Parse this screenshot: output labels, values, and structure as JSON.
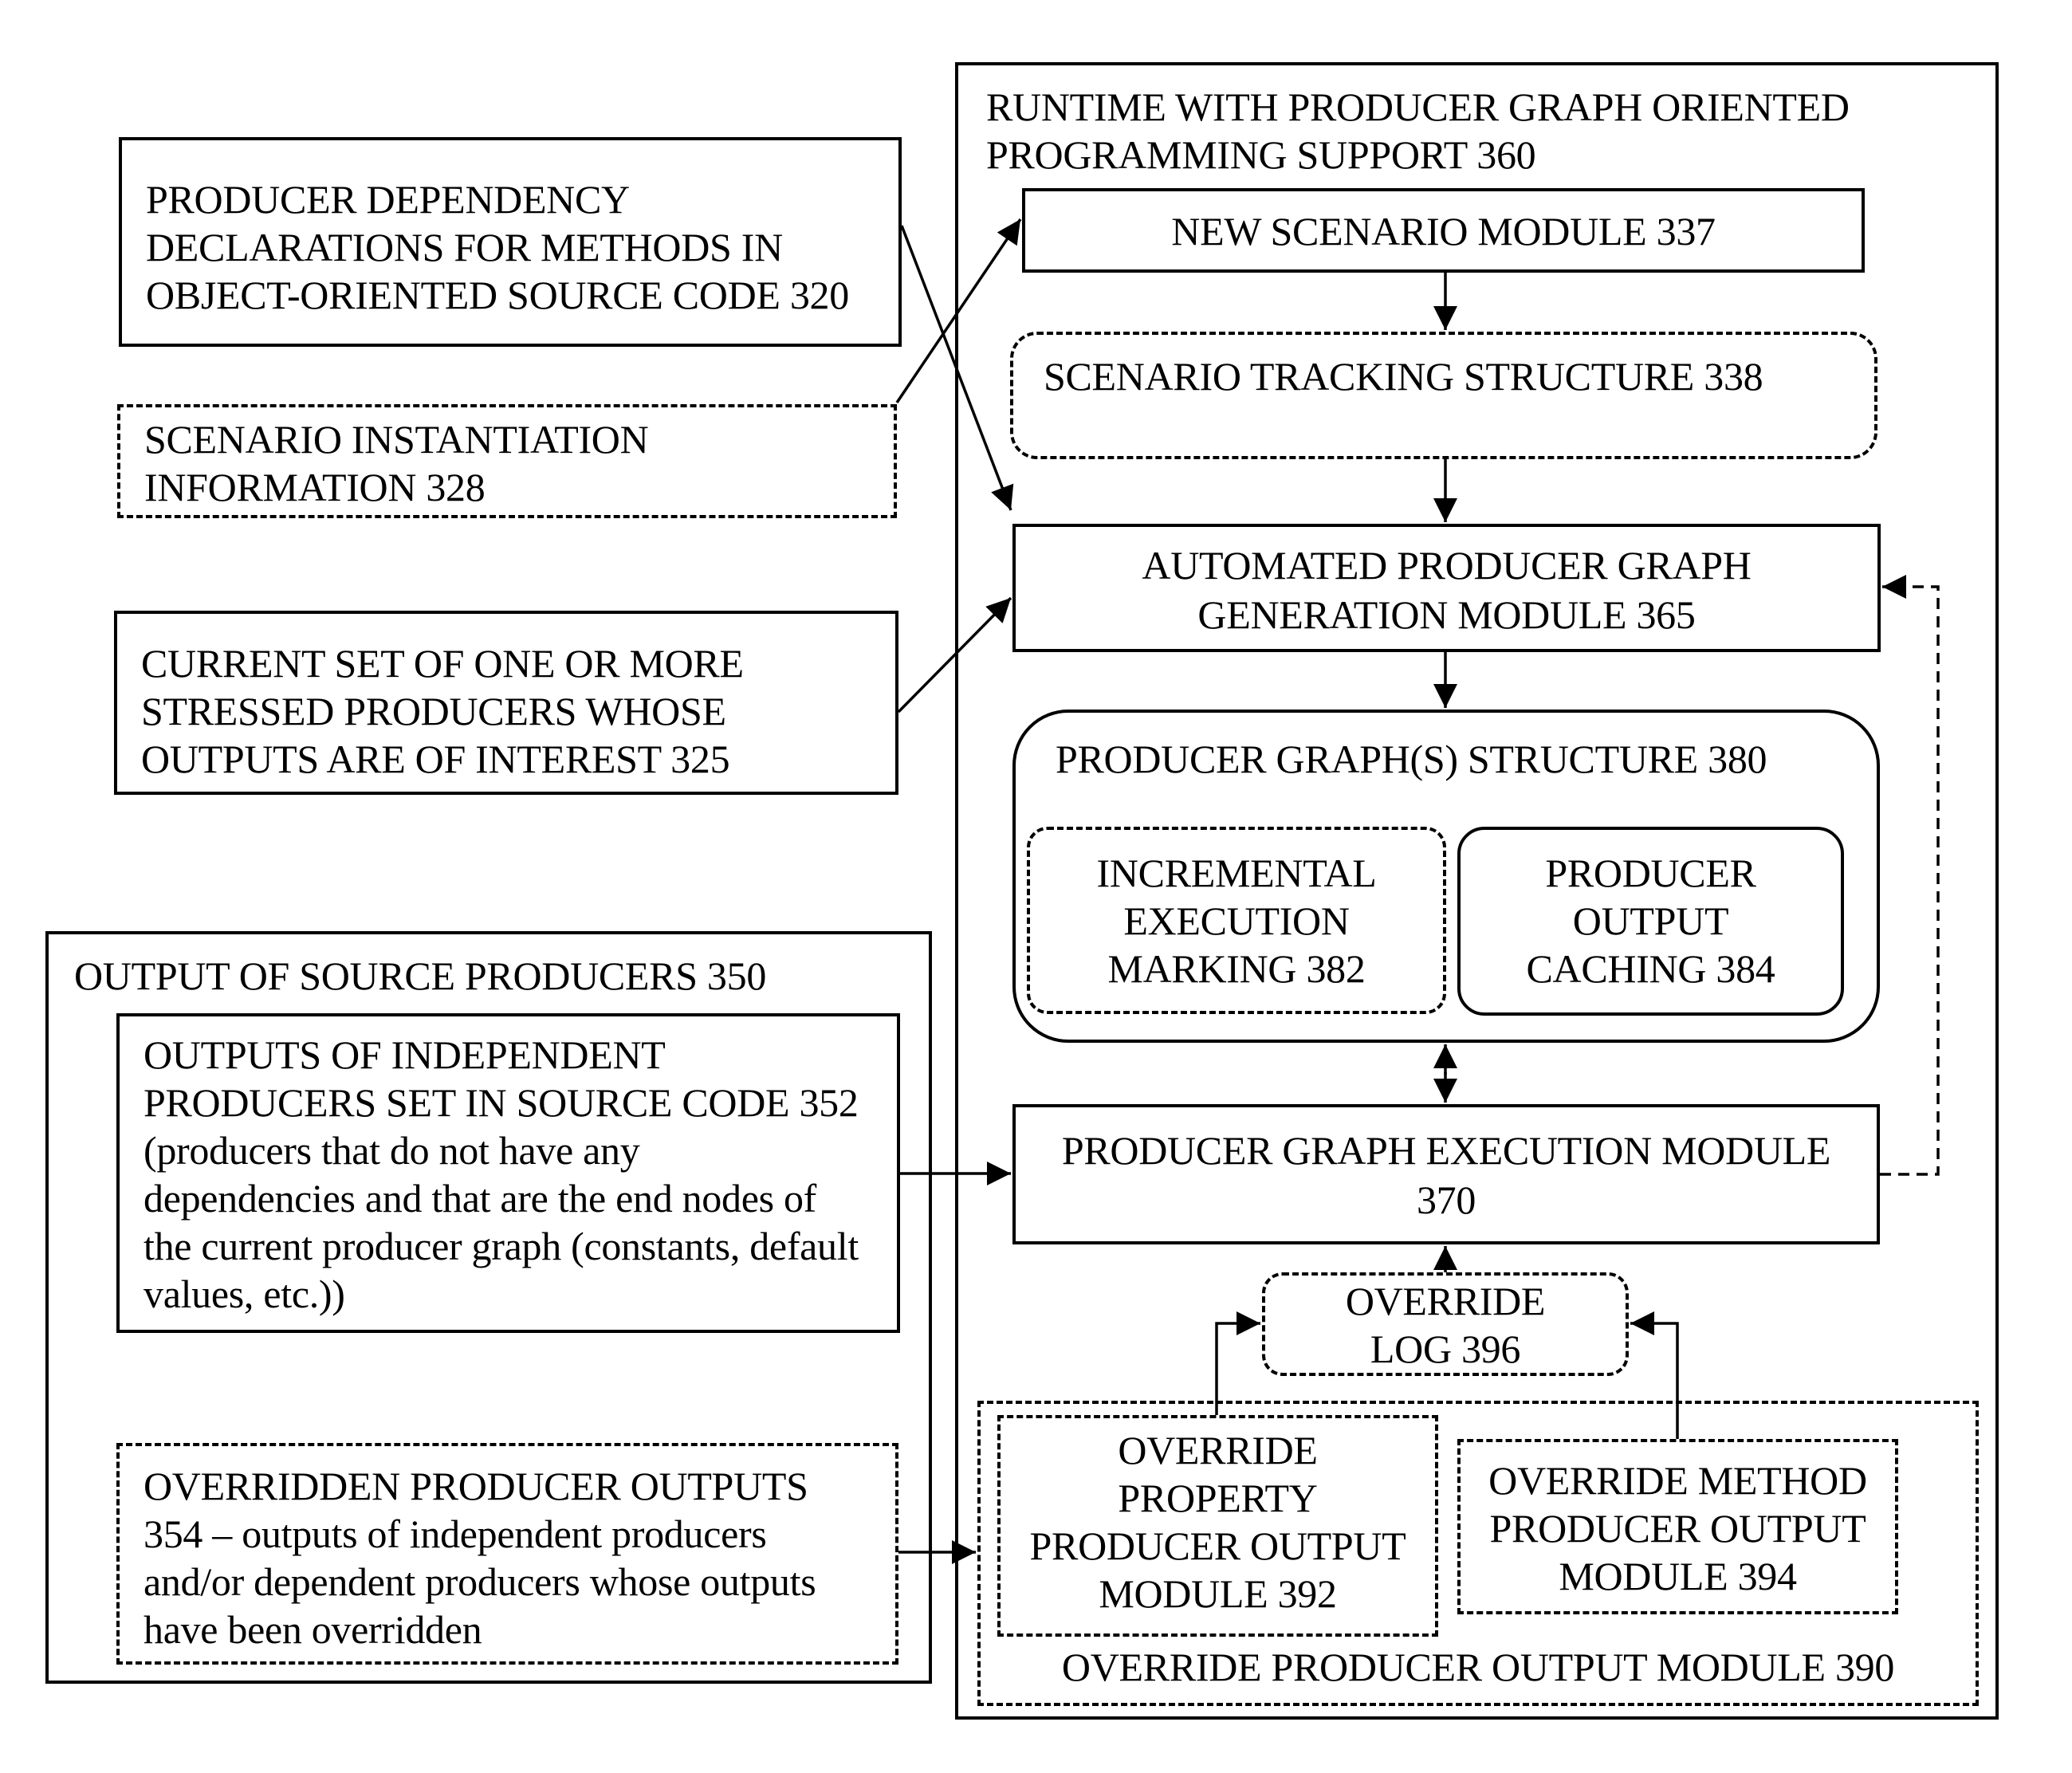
{
  "diagram": {
    "runtime": {
      "title_line1": "RUNTIME WITH PRODUCER GRAPH ORIENTED",
      "title_line2": "PROGRAMMING SUPPORT 360"
    },
    "inputs": {
      "dependency_declarations": {
        "line1": "PRODUCER DEPENDENCY",
        "line2": "DECLARATIONS FOR METHODS IN",
        "line3": "OBJECT-ORIENTED SOURCE CODE 320"
      },
      "scenario_instantiation": {
        "line1": "SCENARIO INSTANTIATION",
        "line2": "INFORMATION 328"
      },
      "stressed_producers": {
        "line1": "CURRENT SET OF ONE OR MORE",
        "line2": "STRESSED PRODUCERS WHOSE",
        "line3": "OUTPUTS ARE OF INTEREST 325"
      }
    },
    "source_producers": {
      "title": "OUTPUT OF SOURCE PRODUCERS 350",
      "independent": {
        "line1": "OUTPUTS OF INDEPENDENT",
        "line2": "PRODUCERS SET IN SOURCE CODE 352",
        "line3": "(producers that do not have any",
        "line4": "dependencies and that are the end nodes of",
        "line5": "the current producer graph (constants, default",
        "line6": "values, etc.))"
      },
      "overridden": {
        "line1": "OVERRIDDEN PRODUCER OUTPUTS",
        "line2": "354 – outputs of independent producers",
        "line3": "and/or dependent producers whose outputs",
        "line4": "have been overridden"
      }
    },
    "modules": {
      "new_scenario": "NEW SCENARIO MODULE 337",
      "scenario_tracking": "SCENARIO TRACKING STRUCTURE 338",
      "graph_generation": {
        "line1": "AUTOMATED PRODUCER GRAPH",
        "line2": "GENERATION MODULE 365"
      },
      "graph_structure": {
        "title": "PRODUCER GRAPH(S) STRUCTURE 380",
        "incremental": {
          "line1": "INCREMENTAL",
          "line2": "EXECUTION",
          "line3": "MARKING 382"
        },
        "caching": {
          "line1": "PRODUCER",
          "line2": "OUTPUT",
          "line3": "CACHING 384"
        }
      },
      "graph_execution": {
        "line1": "PRODUCER GRAPH EXECUTION MODULE",
        "line2": "370"
      },
      "override_log": {
        "line1": "OVERRIDE",
        "line2": "LOG 396"
      },
      "override_output": {
        "title": "OVERRIDE PRODUCER OUTPUT MODULE 390",
        "property": {
          "line1": "OVERRIDE",
          "line2": "PROPERTY",
          "line3": "PRODUCER OUTPUT",
          "line4": "MODULE 392"
        },
        "method": {
          "line1": "OVERRIDE METHOD",
          "line2": "PRODUCER OUTPUT",
          "line3": "MODULE 394"
        }
      }
    },
    "colors": {
      "ink": "#000000",
      "background": "#ffffff"
    }
  }
}
